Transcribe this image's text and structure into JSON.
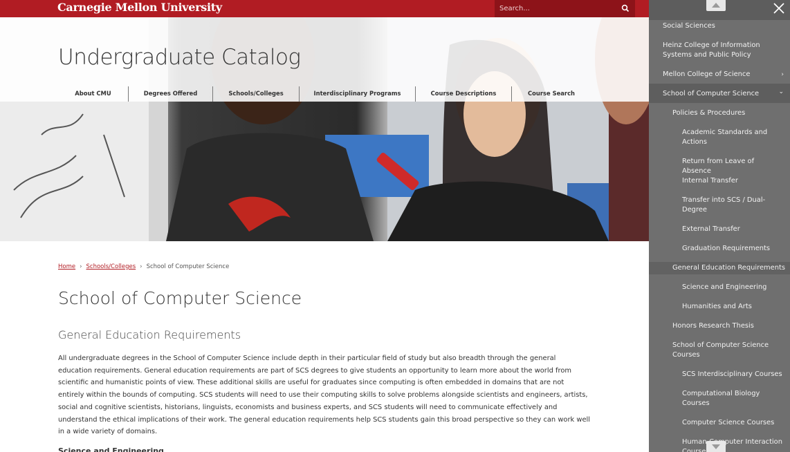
{
  "header": {
    "brand": "Carnegie Mellon University",
    "search_placeholder": "Search..."
  },
  "hero": {
    "title": "Undergraduate Catalog",
    "nav": [
      {
        "label": "About CMU"
      },
      {
        "label": "Degrees Offered"
      },
      {
        "label": "Schools/Colleges"
      },
      {
        "label": "Interdisciplinary Programs"
      },
      {
        "label": "Course Descriptions"
      },
      {
        "label": "Course Search"
      }
    ]
  },
  "breadcrumb": {
    "home": "Home",
    "schools": "Schools/Colleges",
    "current": "School of Computer Science",
    "separator": "›"
  },
  "main": {
    "title": "School of Computer Science",
    "subtitle": "General Education Requirements",
    "body": "All undergraduate degrees in the School of Computer Science include depth in their particular field of study but also breadth through the general education requirements. General education requirements are part of SCS degrees to give students an opportunity to learn more about the world from scientific and humanistic points of view. These additional skills are useful for graduates since computing is often embedded in domains that are not entirely within the bounds of computing. SCS students will need to use their computing skills to solve problems alongside scientists and engineers, artists, social and cognitive scientists, historians, linguists, economists and business experts, and SCS students will need to communicate effectively and understand the ethical implications of their work. The general education requirements help SCS students gain this broad perspective so they can work well in a wide variety of domains.",
    "next_heading": "Science and Engineering"
  },
  "sidebar": {
    "items": [
      {
        "label": "Social Sciences"
      },
      {
        "label": "Heinz College of Information Systems and Public Policy"
      },
      {
        "label": "Mellon College of Science",
        "chevron": "›"
      },
      {
        "label": "School of Computer Science",
        "chevron": "⌄"
      },
      {
        "label": "Policies & Procedures"
      },
      {
        "label": "Academic Standards and Actions"
      },
      {
        "label": "Return from Leave of Absence"
      },
      {
        "label": "Internal Transfer"
      },
      {
        "label": "Transfer into SCS / Dual-Degree"
      },
      {
        "label": "External Transfer"
      },
      {
        "label": "Graduation Requirements"
      },
      {
        "label": "General Education Requirements"
      },
      {
        "label": "Science and Engineering"
      },
      {
        "label": "Humanities and Arts"
      },
      {
        "label": "Honors Research Thesis"
      },
      {
        "label": "School of Computer Science Courses"
      },
      {
        "label": "SCS Interdisciplinary Courses"
      },
      {
        "label": "Computational Biology Courses"
      },
      {
        "label": "Computer Science Courses"
      },
      {
        "label": "Human-Computer Interaction Courses"
      }
    ]
  },
  "colors": {
    "brand_red": "#b11c23",
    "sidebar_bg": "#6f6f6f"
  }
}
